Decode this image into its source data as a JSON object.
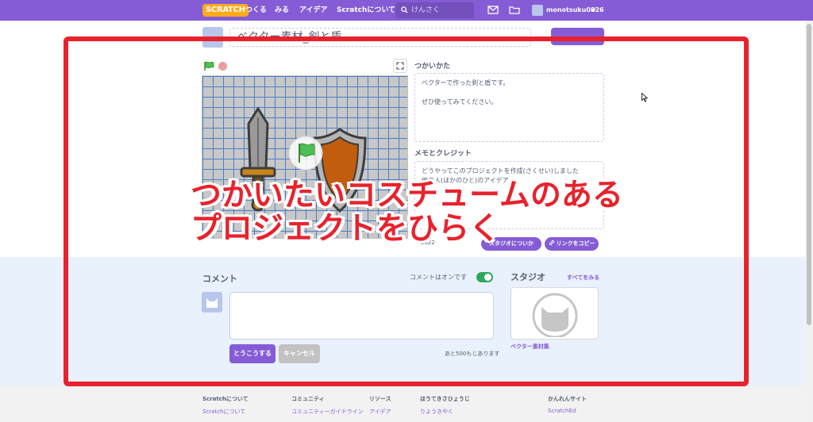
{
  "navbar": {
    "logo": "SCRATCH",
    "links": [
      "つくる",
      "みる",
      "アイデア",
      "Scratchについて"
    ],
    "search_placeholder": "けんさく",
    "username": "monotsuku0826"
  },
  "project": {
    "title": "ベクター素材_剣と盾",
    "instructions_heading": "つかいかた",
    "instructions_lines": [
      "ベクターで作った剣と盾です。",
      "",
      "ぜひ使ってみてください。"
    ],
    "notes_heading": "メモとクレジット",
    "notes_lines": [
      "どうやってこのプロジェクトを作成(さくせい)しました",
      "他の人(ほかのひと)のアイデア"
    ],
    "date": "2022",
    "add_to_studio_label": "スタジオについか",
    "copy_link_label": "リンクをコピー"
  },
  "comments": {
    "title": "コメント",
    "toggle_label": "コメントはオンです",
    "post_label": "とうこうする",
    "cancel_label": "キャンセル",
    "chars_left": "あと500もじあります"
  },
  "studios": {
    "title": "スタジオ",
    "view_all": "すべてをみる",
    "items": [
      {
        "name": "ベクター素材集"
      }
    ]
  },
  "footer": {
    "columns": [
      {
        "heading": "Scratchについて",
        "link": "Scratchについて"
      },
      {
        "heading": "コミュニティ",
        "link": "コミュニティーガイドライン"
      },
      {
        "heading": "リソース",
        "link": "アイデア"
      },
      {
        "heading": "ほうてきさひょうじ",
        "link": "りようきやく"
      },
      {
        "heading": "かんれんサイト",
        "link": "ScratchEd"
      }
    ]
  },
  "annotation": {
    "line1": "つかいたいコスチュームのある",
    "line2": "プロジェクトをひらく",
    "color": "#e8222c"
  },
  "colors": {
    "brand": "#855cd6",
    "nav": "#855cd6",
    "toggle_on": "#2ea860"
  }
}
